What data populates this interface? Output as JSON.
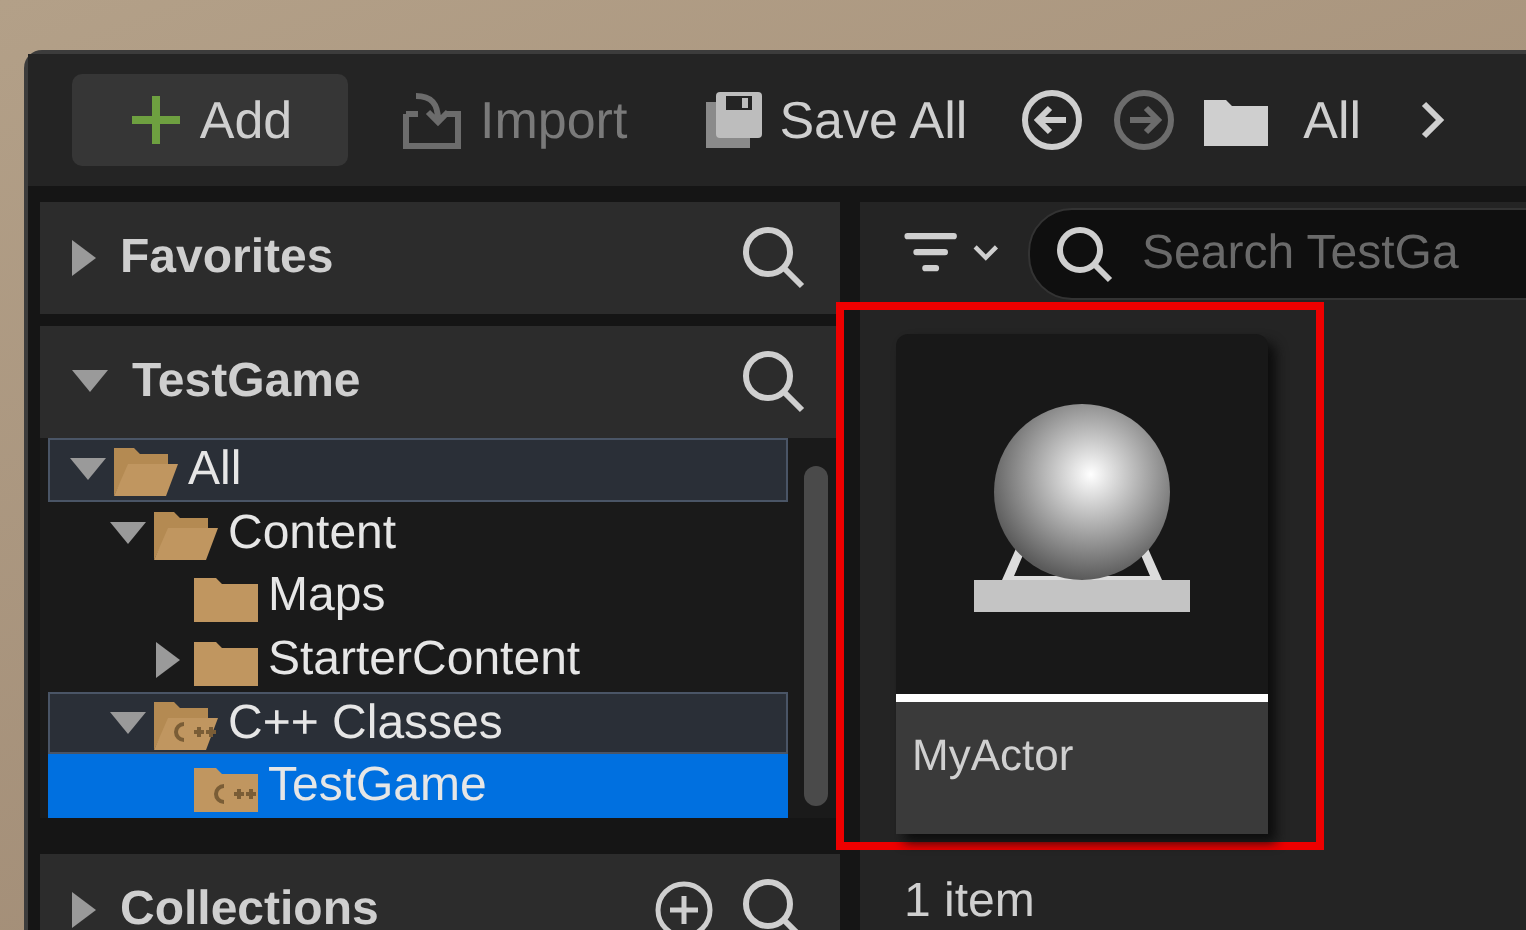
{
  "toolbar": {
    "add": {
      "label": "Add",
      "disabled": false
    },
    "import": {
      "label": "Import",
      "disabled": true
    },
    "save_all": {
      "label": "Save All",
      "disabled": false
    },
    "back": {
      "disabled": false
    },
    "forward": {
      "disabled": true
    },
    "path": "All"
  },
  "sidebar": {
    "sections": [
      {
        "title": "Favorites",
        "expanded": false,
        "add_button": false
      },
      {
        "title": "TestGame",
        "expanded": true,
        "add_button": false
      },
      {
        "title": "Collections",
        "expanded": false,
        "add_button": true
      }
    ],
    "tree": [
      {
        "label": "All",
        "kind": "content",
        "expanded": true,
        "selected": false,
        "highlighted": true,
        "children": [
          {
            "label": "Content",
            "kind": "content",
            "expanded": true,
            "selected": false,
            "highlighted": false,
            "children": [
              {
                "label": "Maps",
                "kind": "content",
                "selected": false,
                "highlighted": false
              },
              {
                "label": "StarterContent",
                "kind": "content",
                "expanded": false,
                "selected": false,
                "highlighted": false
              }
            ]
          },
          {
            "label": "C++ Classes",
            "kind": "cpp",
            "expanded": true,
            "selected": false,
            "highlighted": true,
            "children": [
              {
                "label": "TestGame",
                "kind": "cpp",
                "selected": true,
                "highlighted": false
              }
            ]
          }
        ]
      }
    ]
  },
  "content": {
    "search": {
      "placeholder": "Search TestGa"
    },
    "assets": [
      {
        "name": "MyActor",
        "highlighted": true
      }
    ],
    "status": "1 item"
  }
}
